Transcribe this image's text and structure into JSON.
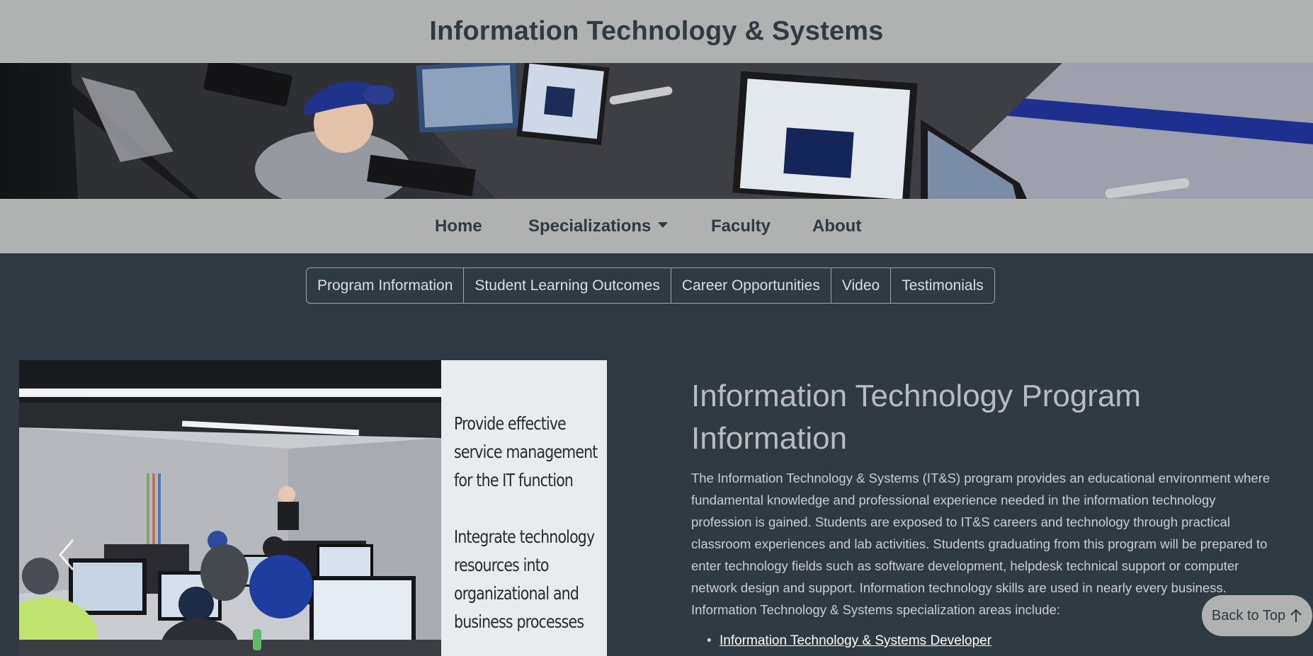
{
  "header": {
    "title": "Information Technology & Systems"
  },
  "nav": {
    "items": [
      {
        "label": "Home"
      },
      {
        "label": "Specializations"
      },
      {
        "label": "Faculty"
      },
      {
        "label": "About"
      }
    ]
  },
  "subnav": {
    "items": [
      {
        "label": "Program Information"
      },
      {
        "label": "Student Learning Outcomes"
      },
      {
        "label": "Career Opportunities"
      },
      {
        "label": "Video"
      },
      {
        "label": "Testimonials"
      }
    ]
  },
  "carousel": {
    "lines": [
      "Provide effective",
      "service  management",
      "for the IT function",
      "Integrate technology",
      "resources into",
      "organizational and",
      "business processes"
    ]
  },
  "content": {
    "heading_line1": "Information Technology Program",
    "heading_line2": "Information",
    "paragraph": "The Information Technology & Systems (IT&S) program provides an educational environment where fundamental knowledge and professional experience needed in the information technology profession is gained. Students are exposed to IT&S careers and technology through practical classroom experiences and lab activities. Students graduating from this program will be prepared to enter technology fields such as software development, helpdesk technical support or computer network design and support. Information technology skills are used in nearly every business. Information Technology & Systems specialization areas include:",
    "list": [
      {
        "label": "Information Technology & Systems Developer"
      }
    ]
  },
  "back_to_top": {
    "label": "Back to Top",
    "icon": "arrow-up-icon"
  },
  "colors": {
    "header_bg": "#b0b2b1",
    "page_bg": "#2f3a43",
    "title_text": "#2f3a43"
  }
}
